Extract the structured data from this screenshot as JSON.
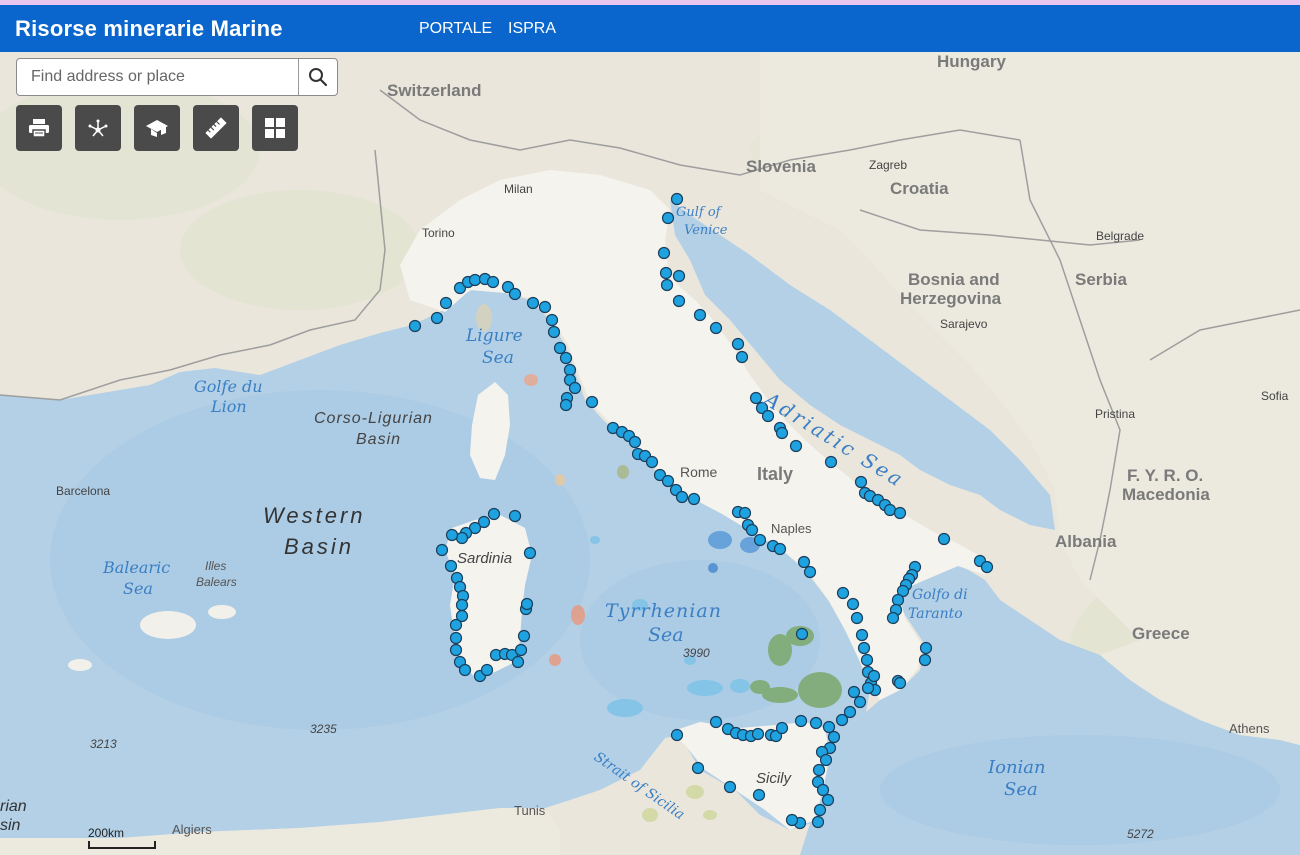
{
  "app": {
    "title": "Risorse minerarie Marine"
  },
  "nav": {
    "links": [
      "PORTALE",
      "ISPRA"
    ]
  },
  "search": {
    "placeholder": "Find address or place"
  },
  "toolbar": {
    "tools": [
      "print-icon",
      "share-icon",
      "basemap-icon",
      "measure-icon",
      "apps-grid-icon"
    ]
  },
  "scale": {
    "label": "200km"
  },
  "map": {
    "countries": [
      "Hungary",
      "Switzerland",
      "Slovenia",
      "Croatia",
      "Bosnia and",
      "Herzegovina",
      "Serbia",
      "Italy",
      "Albania",
      "F. Y. R. O.",
      "Macedonia",
      "Greece"
    ],
    "cities": [
      "Milan",
      "Torino",
      "Zagreb",
      "Belgrade",
      "Sarajevo",
      "Rome",
      "Naples",
      "Pristina",
      "Sofia",
      "Barcelona",
      "Tunis",
      "Algiers",
      "Athens",
      "Illes",
      "Balears",
      "Sardinia",
      "Sicily"
    ],
    "seas": [
      "Gulf of",
      "Venice",
      "Ligure",
      "Sea",
      "Golfe du",
      "Lion",
      "Adriatic Sea",
      "Balearic",
      "Sea",
      "Tyrrhenian",
      "Sea",
      "Golfo di",
      "Taranto",
      "Ionian",
      "Sea",
      "Strait of Sicilia"
    ],
    "basins": [
      "Corso-Ligurian",
      "Basin",
      "Western",
      "Basin",
      "rian",
      "sin"
    ],
    "depths": [
      "3990",
      "3235",
      "3213",
      "5272"
    ]
  }
}
